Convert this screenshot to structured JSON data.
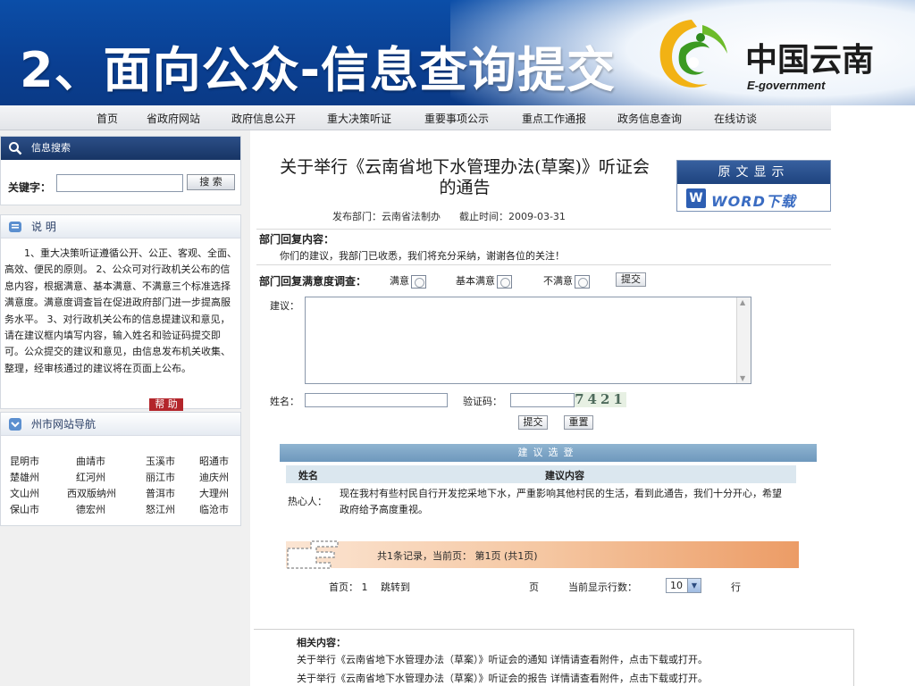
{
  "slide": {
    "title": "2、面向公众-信息查询提交",
    "logo_cn": "中国云南",
    "logo_en": "E-government"
  },
  "nav": {
    "items": [
      "首页",
      "省政府网站",
      "政府信息公开",
      "重大决策听证",
      "重要事项公示",
      "重点工作通报",
      "政务信息查询",
      "在线访谈"
    ]
  },
  "sidebar": {
    "search": {
      "title": "信息搜索",
      "keyword_label": "关键字：",
      "keyword_value": "",
      "button": "搜 索"
    },
    "desc": {
      "title": "说  明",
      "text": "1、重大决策听证遵循公开、公正、客观、全面、高效、便民的原则。 2、公众可对行政机关公布的信息内容，根据满意、基本满意、不满意三个标准选择满意度。满意度调查旨在促进政府部门进一步提高服务水平。 3、对行政机关公布的信息提建议和意见，请在建议框内填写内容，输入姓名和验证码提交即可。公众提交的建议和意见，由信息发布机关收集、整理，经审核通过的建议将在页面上公布。",
      "help_button": "帮 助"
    },
    "cities": {
      "title": "州市网站导航",
      "items": [
        "昆明市",
        "曲靖市",
        "玉溪市",
        "昭通市",
        "楚雄州",
        "红河州",
        "丽江市",
        "迪庆州",
        "文山州",
        "西双版纳州",
        "普洱市",
        "大理州",
        "保山市",
        "德宏州",
        "怒江州",
        "临沧市"
      ]
    }
  },
  "notice": {
    "title": "关于举行《云南省地下水管理办法(草案)》听证会的通告",
    "dept_label": "发布部门：",
    "dept": "云南省法制办",
    "deadline_label": "截止时间：",
    "deadline": "2009-03-31"
  },
  "original": {
    "title": "原文显示",
    "word_download": "WORD下载",
    "word_icon": "W"
  },
  "reply": {
    "label": "部门回复内容：",
    "text": "你们的建议，我部门已收悉，我们将充分采纳，谢谢各位的关注！"
  },
  "survey": {
    "label": "部门回复满意度调查：",
    "options": [
      "满意",
      "基本满意",
      "不满意"
    ],
    "submit": "提交"
  },
  "form": {
    "suggestion_label": "建议：",
    "suggestion_value": "",
    "name_label": "姓名：",
    "name_value": "",
    "code_label": "验证码：",
    "code_value": "",
    "captcha": "7421",
    "submit": "提交",
    "reset": "重置"
  },
  "suggestions": {
    "title": "建议选登",
    "col_name": "姓名",
    "col_content": "建议内容",
    "rows": [
      {
        "name": "热心人：",
        "content": "现在我村有些村民自行开发挖采地下水，严重影响其他村民的生活，看到此通告，我们十分开心，希望政府给予高度重视。"
      }
    ]
  },
  "pager": {
    "summary": "共1条记录，当前页：  第1页  (共1页)",
    "first_label": "首页：",
    "first_value": "1",
    "jump_label": "跳转到",
    "page_unit": "页",
    "rows_label": "当前显示行数：",
    "rows_value": "10",
    "rows_unit": "行"
  },
  "related": {
    "label": "相关内容：",
    "items": [
      "关于举行《云南省地下水管理办法（草案）》听证会的通知  详情请查看附件，点击下载或打开。",
      "关于举行《云南省地下水管理办法（草案）》听证会的报告  详情请查看附件，点击下载或打开。"
    ]
  },
  "colors": {
    "header_blue": "#0a3f92",
    "panel_dark": "#1e437e",
    "help_red": "#b3252b",
    "pager_orange": "#ec9c66",
    "sugg_bar": "#7fa6c8"
  }
}
